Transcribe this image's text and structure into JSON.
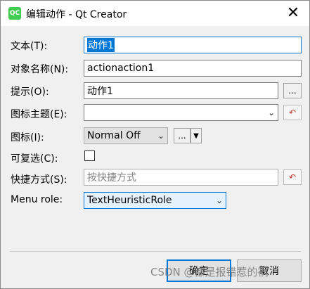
{
  "window": {
    "title": "编辑动作 - Qt Creator",
    "icon_text": "QC",
    "close_glyph": "✕"
  },
  "form": {
    "text": {
      "label": "文本(T):",
      "value": "动作1"
    },
    "object_name": {
      "label": "对象名称(N):",
      "value": "actionaction1"
    },
    "tooltip": {
      "label": "提示(O):",
      "value": "动作1",
      "browse_label": "..."
    },
    "icon_theme": {
      "label": "图标主题(E):",
      "value": ""
    },
    "icon": {
      "label": "图标(I):",
      "mode_value": "Normal Off",
      "browse_label": "..."
    },
    "checkable": {
      "label": "可复选(C):",
      "checked": false
    },
    "shortcut": {
      "label": "快捷方式(S):",
      "placeholder": "按快捷方式"
    },
    "menu_role": {
      "label": "Menu role:",
      "value": "TextHeuristicRole"
    }
  },
  "buttons": {
    "ok": "确定",
    "cancel": "取消"
  },
  "watermark": "CSDN @都是报错惹的祸",
  "colors": {
    "accent": "#0078d7",
    "reset_icon": "#c0392b",
    "qt_green": "#41cd52"
  }
}
